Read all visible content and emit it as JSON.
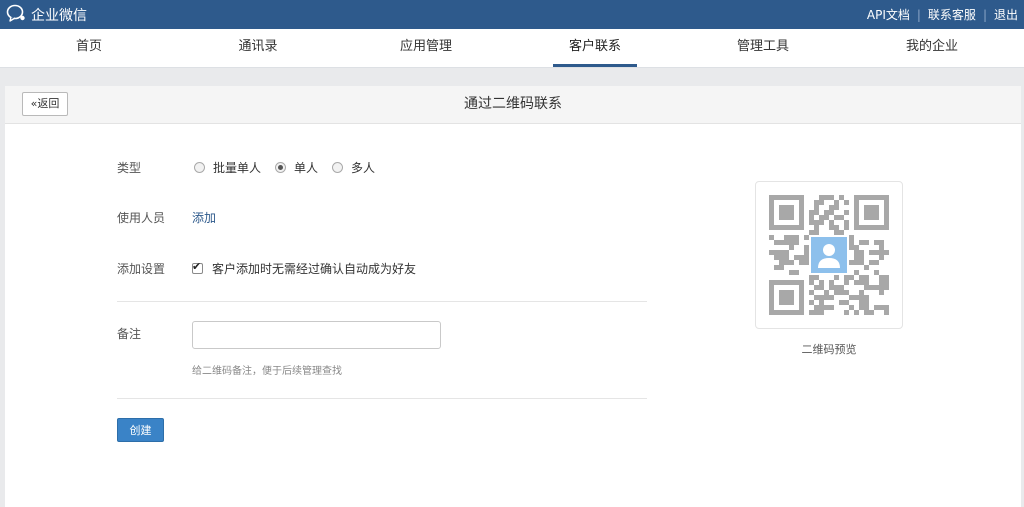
{
  "app": {
    "name": "企业微信"
  },
  "topbar": {
    "links": [
      "API文档",
      "联系客服",
      "退出"
    ]
  },
  "nav": {
    "items": [
      "首页",
      "通讯录",
      "应用管理",
      "客户联系",
      "管理工具",
      "我的企业"
    ],
    "active": "客户联系"
  },
  "panel": {
    "back_label": "返回",
    "title": "通过二维码联系"
  },
  "form": {
    "type_label": "类型",
    "type_options": [
      "批量单人",
      "单人",
      "多人"
    ],
    "type_selected": "单人",
    "members_label": "使用人员",
    "add_link": "添加",
    "settings_label": "添加设置",
    "auto_accept_label": "客户添加时无需经过确认自动成为好友",
    "auto_accept_checked": true,
    "note_label": "备注",
    "note_value": "",
    "note_hint": "给二维码备注，便于后续管理查找",
    "create_label": "创建"
  },
  "qr_preview": {
    "caption": "二维码预览",
    "icon": "user-avatar-icon"
  },
  "colors": {
    "topbar": "#2e5a8c",
    "accent": "#3a83c7",
    "link": "#2e5a8c",
    "avatar": "#8dc0ec"
  }
}
